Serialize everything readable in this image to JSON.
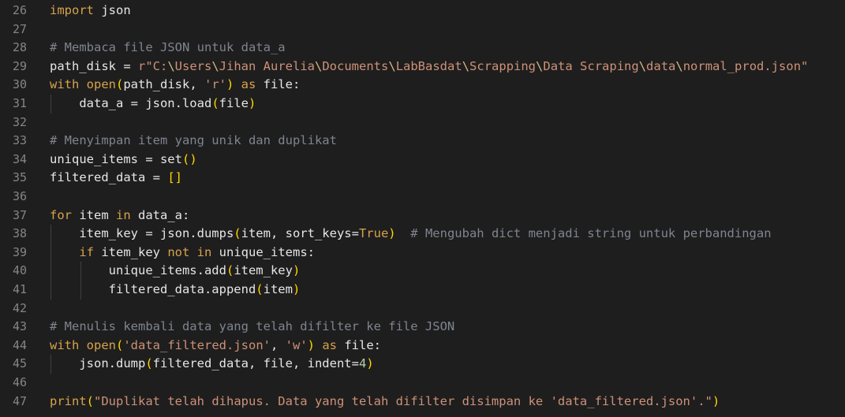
{
  "editor": {
    "language": "python",
    "colors": {
      "background": "#1e1e1e",
      "line_number": "#858585",
      "keyword": "#d9a24a",
      "string": "#ce9178",
      "comment": "#7f848e",
      "bracket_outer": "#ffd700",
      "bracket_inner": "#da70d6",
      "number": "#b5cea8"
    },
    "lines": [
      {
        "number": "26",
        "tokens": [
          {
            "t": "import",
            "c": "kw"
          },
          {
            "t": " json",
            "c": "id"
          }
        ]
      },
      {
        "number": "27",
        "tokens": []
      },
      {
        "number": "28",
        "tokens": [
          {
            "t": "# Membaca file JSON untuk data_a",
            "c": "com"
          }
        ]
      },
      {
        "number": "29",
        "tokens": [
          {
            "t": "path_disk = ",
            "c": "id"
          },
          {
            "t": "r\"C:",
            "c": "str"
          },
          {
            "t": "\\",
            "c": "esc"
          },
          {
            "t": "Users",
            "c": "str"
          },
          {
            "t": "\\",
            "c": "esc"
          },
          {
            "t": "Jihan Aurelia",
            "c": "str"
          },
          {
            "t": "\\",
            "c": "esc"
          },
          {
            "t": "Documents",
            "c": "str"
          },
          {
            "t": "\\",
            "c": "esc"
          },
          {
            "t": "LabBasdat",
            "c": "str"
          },
          {
            "t": "\\",
            "c": "esc"
          },
          {
            "t": "Scrapping",
            "c": "str"
          },
          {
            "t": "\\",
            "c": "esc"
          },
          {
            "t": "Data Scraping",
            "c": "str"
          },
          {
            "t": "\\",
            "c": "esc"
          },
          {
            "t": "data",
            "c": "str"
          },
          {
            "t": "\\",
            "c": "esc"
          },
          {
            "t": "normal_prod.json\"",
            "c": "str"
          }
        ]
      },
      {
        "number": "30",
        "tokens": [
          {
            "t": "with",
            "c": "kw"
          },
          {
            "t": " open",
            "c": "kw"
          },
          {
            "t": "(",
            "c": "br1"
          },
          {
            "t": "path_disk, ",
            "c": "id"
          },
          {
            "t": "'r'",
            "c": "str"
          },
          {
            "t": ")",
            "c": "br1"
          },
          {
            "t": " as",
            "c": "kw"
          },
          {
            "t": " file:",
            "c": "id"
          }
        ]
      },
      {
        "number": "31",
        "tokens": [
          {
            "t": "    data_a = json.load",
            "c": "id"
          },
          {
            "t": "(",
            "c": "br1"
          },
          {
            "t": "file",
            "c": "id"
          },
          {
            "t": ")",
            "c": "br1"
          }
        ]
      },
      {
        "number": "32",
        "tokens": []
      },
      {
        "number": "33",
        "tokens": [
          {
            "t": "# Menyimpan item yang unik dan duplikat",
            "c": "com"
          }
        ]
      },
      {
        "number": "34",
        "tokens": [
          {
            "t": "unique_items = set",
            "c": "id"
          },
          {
            "t": "()",
            "c": "br1"
          }
        ]
      },
      {
        "number": "35",
        "tokens": [
          {
            "t": "filtered_data = ",
            "c": "id"
          },
          {
            "t": "[]",
            "c": "br1"
          }
        ]
      },
      {
        "number": "36",
        "tokens": []
      },
      {
        "number": "37",
        "tokens": [
          {
            "t": "for",
            "c": "kw"
          },
          {
            "t": " item ",
            "c": "id"
          },
          {
            "t": "in",
            "c": "kw"
          },
          {
            "t": " data_a:",
            "c": "id"
          }
        ]
      },
      {
        "number": "38",
        "tokens": [
          {
            "t": "    item_key = json.dumps",
            "c": "id"
          },
          {
            "t": "(",
            "c": "br1"
          },
          {
            "t": "item, sort_keys=",
            "c": "id"
          },
          {
            "t": "True",
            "c": "const"
          },
          {
            "t": ")",
            "c": "br1"
          },
          {
            "t": "  # Mengubah dict menjadi string untuk perbandingan",
            "c": "com"
          }
        ]
      },
      {
        "number": "39",
        "tokens": [
          {
            "t": "    ",
            "c": "id"
          },
          {
            "t": "if",
            "c": "kw"
          },
          {
            "t": " item_key ",
            "c": "id"
          },
          {
            "t": "not",
            "c": "kw"
          },
          {
            "t": " ",
            "c": "id"
          },
          {
            "t": "in",
            "c": "kw"
          },
          {
            "t": " unique_items:",
            "c": "id"
          }
        ]
      },
      {
        "number": "40",
        "tokens": [
          {
            "t": "        unique_items.add",
            "c": "id"
          },
          {
            "t": "(",
            "c": "br1"
          },
          {
            "t": "item_key",
            "c": "id"
          },
          {
            "t": ")",
            "c": "br1"
          }
        ]
      },
      {
        "number": "41",
        "tokens": [
          {
            "t": "        filtered_data.append",
            "c": "id"
          },
          {
            "t": "(",
            "c": "br1"
          },
          {
            "t": "item",
            "c": "id"
          },
          {
            "t": ")",
            "c": "br1"
          }
        ]
      },
      {
        "number": "42",
        "tokens": []
      },
      {
        "number": "43",
        "tokens": [
          {
            "t": "# Menulis kembali data yang telah difilter ke file JSON",
            "c": "com"
          }
        ]
      },
      {
        "number": "44",
        "tokens": [
          {
            "t": "with",
            "c": "kw"
          },
          {
            "t": " open",
            "c": "kw"
          },
          {
            "t": "(",
            "c": "br1"
          },
          {
            "t": "'data_filtered.json'",
            "c": "str"
          },
          {
            "t": ", ",
            "c": "id"
          },
          {
            "t": "'w'",
            "c": "str"
          },
          {
            "t": ")",
            "c": "br1"
          },
          {
            "t": " as",
            "c": "kw"
          },
          {
            "t": " file:",
            "c": "id"
          }
        ]
      },
      {
        "number": "45",
        "tokens": [
          {
            "t": "    json.dump",
            "c": "id"
          },
          {
            "t": "(",
            "c": "br1"
          },
          {
            "t": "filtered_data, file, indent=",
            "c": "id"
          },
          {
            "t": "4",
            "c": "num"
          },
          {
            "t": ")",
            "c": "br1"
          }
        ]
      },
      {
        "number": "46",
        "tokens": []
      },
      {
        "number": "47",
        "tokens": [
          {
            "t": "print",
            "c": "kw"
          },
          {
            "t": "(",
            "c": "br1"
          },
          {
            "t": "\"Duplikat telah dihapus. Data yang telah difilter disimpan ke 'data_filtered.json'.\"",
            "c": "str"
          },
          {
            "t": ")",
            "c": "br1"
          }
        ]
      }
    ]
  }
}
